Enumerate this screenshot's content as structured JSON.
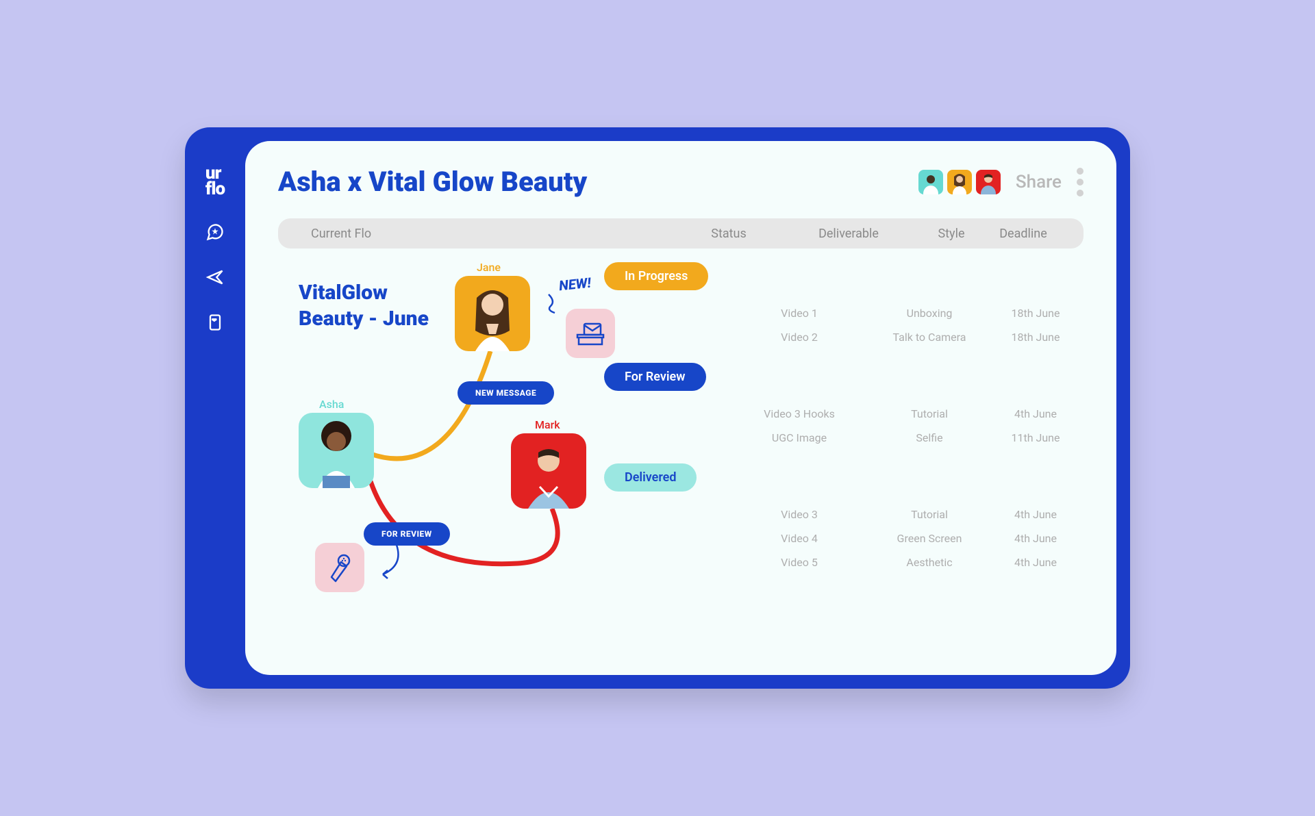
{
  "header": {
    "title": "Asha x Vital Glow Beauty",
    "share_label": "Share"
  },
  "tabs": {
    "current": "Current Flo",
    "status": "Status",
    "deliverable": "Deliverable",
    "style": "Style",
    "deadline": "Deadline"
  },
  "flo": {
    "title": "VitalGlow Beauty - June",
    "people": {
      "asha": "Asha",
      "jane": "Jane",
      "mark": "Mark"
    },
    "pill_new_message": "New Message",
    "pill_for_review": "For Review",
    "new_callout": "NEW!"
  },
  "status": {
    "in_progress": {
      "label": "In Progress",
      "rows": [
        {
          "deliverable": "Video 1",
          "style": "Unboxing",
          "deadline": "18th June"
        },
        {
          "deliverable": "Video 2",
          "style": "Talk to Camera",
          "deadline": "18th June"
        }
      ]
    },
    "for_review": {
      "label": "For Review",
      "rows": [
        {
          "deliverable": "Video 3 Hooks",
          "style": "Tutorial",
          "deadline": "4th June"
        },
        {
          "deliverable": "UGC Image",
          "style": "Selfie",
          "deadline": "11th June"
        }
      ]
    },
    "delivered": {
      "label": "Delivered",
      "rows": [
        {
          "deliverable": "Video 3",
          "style": "Tutorial",
          "deadline": "4th June"
        },
        {
          "deliverable": "Video 4",
          "style": "Green Screen",
          "deadline": "4th June"
        },
        {
          "deliverable": "Video 5",
          "style": "Aesthetic",
          "deadline": "4th June"
        }
      ]
    }
  },
  "colors": {
    "primary": "#1746c8",
    "amber": "#f2a91d",
    "red": "#e22222",
    "teal": "#66d9d1",
    "mint_bg": "#9be7e1"
  }
}
